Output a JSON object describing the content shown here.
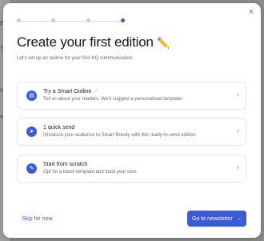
{
  "background": {
    "fragments": [
      "n",
      "T",
      "M",
      "e"
    ]
  },
  "modal": {
    "close_glyph": "×",
    "stepper": {
      "steps": 4,
      "active_step": 4
    },
    "title": "Create your first edition",
    "title_emoji": "✏️",
    "subtitle": "Let's set up an outline for your first HQ communication.",
    "options": [
      {
        "title": "Try a Smart Outline",
        "title_icon": "magic-wand-icon",
        "description": "Tell us about your readers. We'll suggest a personalized template.",
        "icon": "smart-outline-icon"
      },
      {
        "title": "1 quick send",
        "description": "Introduce your audience to Smart Brevity with this ready-to-send edition.",
        "icon": "quick-send-icon"
      },
      {
        "title": "Start from scratch",
        "description": "Opt for a blank template and build your own.",
        "icon": "pen-icon"
      }
    ],
    "skip_label": "Skip for now",
    "primary_label": "Go to newsletter",
    "primary_arrow": "→"
  },
  "colors": {
    "accent": "#3b5bd6",
    "overlay": "#8d8d8d"
  }
}
